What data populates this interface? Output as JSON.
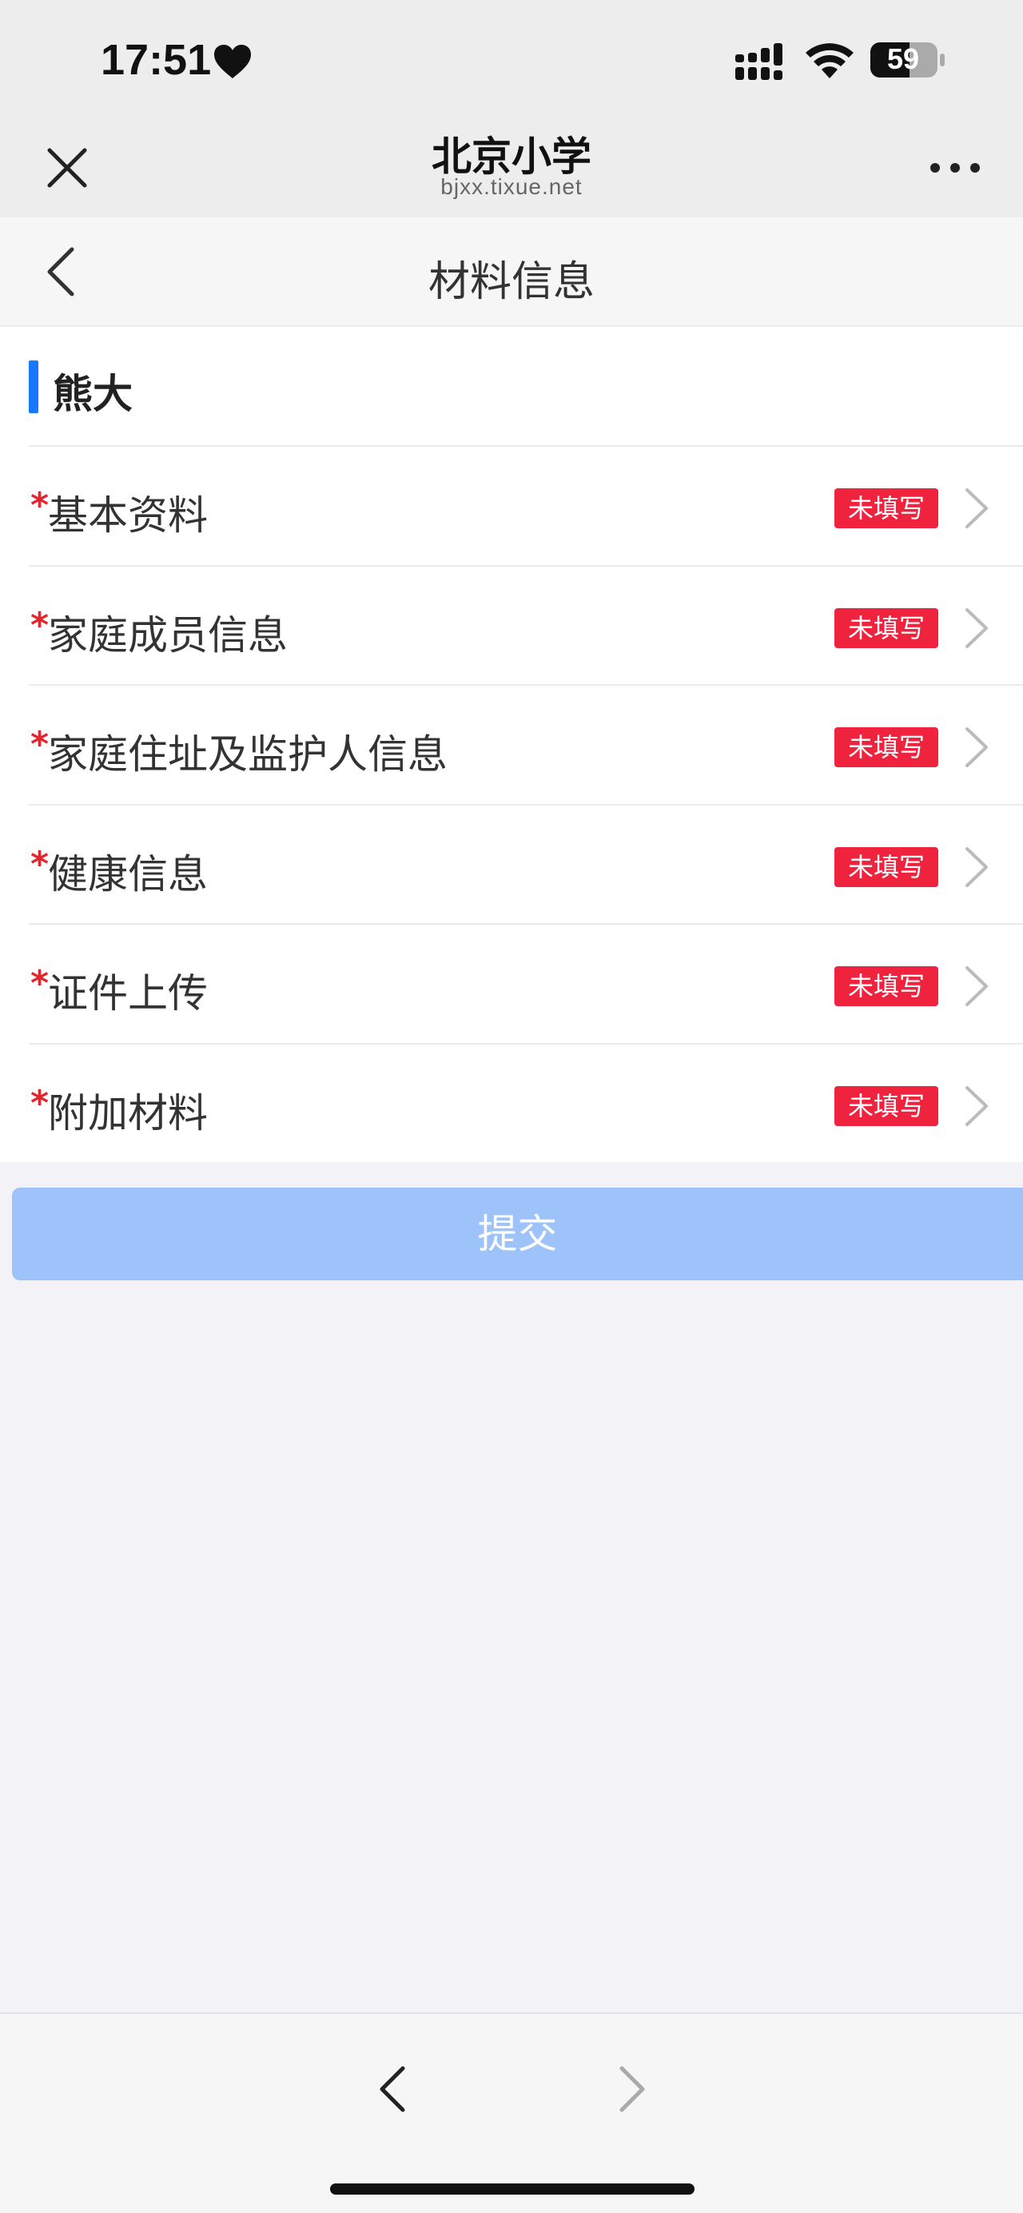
{
  "status_bar": {
    "time": "17:51",
    "battery": "59",
    "icons": [
      "heart-icon",
      "signal-icon",
      "wifi-icon",
      "battery-icon"
    ]
  },
  "browser": {
    "title": "北京小学",
    "url": "bjxx.tixue.net",
    "icons": [
      "close-icon",
      "more-icon"
    ]
  },
  "page": {
    "title": "材料信息",
    "back_icon": "chevron-left-icon"
  },
  "student": {
    "name": "熊大",
    "accent_color": "#1677ff"
  },
  "required_marker": "*",
  "items": [
    {
      "label": "基本资料",
      "status": "未填写"
    },
    {
      "label": "家庭成员信息",
      "status": "未填写"
    },
    {
      "label": "家庭住址及监护人信息",
      "status": "未填写"
    },
    {
      "label": "健康信息",
      "status": "未填写"
    },
    {
      "label": "证件上传",
      "status": "未填写"
    },
    {
      "label": "附加材料",
      "status": "未填写"
    }
  ],
  "submit": {
    "label": "提交",
    "color": "#9ec3fa"
  },
  "colors": {
    "required_star": "#e3252e",
    "status_badge": "#f0233f"
  },
  "bottom_nav": {
    "icons": [
      "nav-back-icon",
      "nav-forward-icon"
    ]
  }
}
